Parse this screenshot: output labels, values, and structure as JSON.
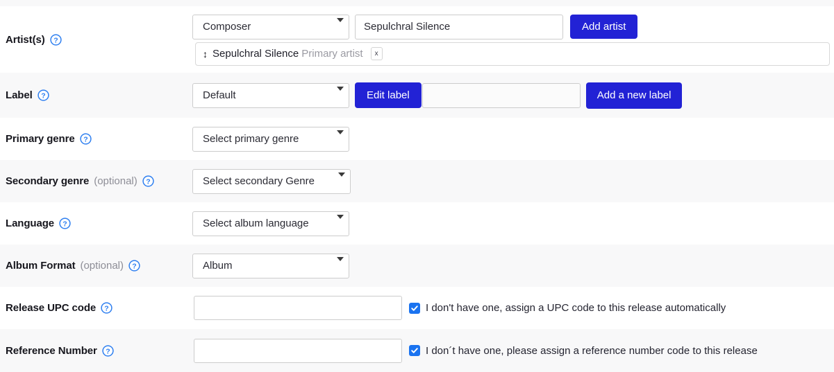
{
  "rows": {
    "artist": {
      "label": "Artist(s)",
      "help_icon": "help-circle-icon",
      "artist_type_select": "Composer",
      "artist_name_value": "Sepulchral Silence",
      "artist_name_placeholder": "",
      "add_button": "Add artist",
      "added": [
        {
          "drag_icon": "drag-vertical-icon",
          "name": "Sepulchral Silence",
          "role": "Primary artist",
          "remove_label": "x"
        }
      ]
    },
    "label": {
      "label": "Label",
      "help_icon": "help-circle-icon",
      "select_value": "Default",
      "edit_button": "Edit label",
      "new_label_value": "",
      "new_label_placeholder": "",
      "add_button": "Add a new label"
    },
    "primary_genre": {
      "label": "Primary genre",
      "help_icon": "help-circle-icon",
      "select_value": "Select primary genre"
    },
    "secondary_genre": {
      "label": "Secondary genre",
      "optional": "(optional)",
      "help_icon": "help-circle-icon",
      "select_value": "Select secondary Genre"
    },
    "language": {
      "label": "Language",
      "help_icon": "help-circle-icon",
      "select_value": "Select album language"
    },
    "album_format": {
      "label": "Album Format",
      "optional": "(optional)",
      "help_icon": "help-circle-icon",
      "select_value": "Album"
    },
    "upc": {
      "label": "Release UPC code",
      "help_icon": "help-circle-icon",
      "input_value": "",
      "input_placeholder": "",
      "checkbox_checked": true,
      "checkbox_text": "I don't have one, assign a UPC code to this release automatically"
    },
    "reference": {
      "label": "Reference Number",
      "help_icon": "help-circle-icon",
      "input_value": "",
      "input_placeholder": "",
      "checkbox_checked": true,
      "checkbox_text": "I don´t have one, please assign a reference number code to this release"
    }
  },
  "colors": {
    "accent_blue": "#2222d5",
    "checkbox_blue": "#1a73f0",
    "help_icon_blue": "#2e7ff0",
    "row_shade": "#f8f8f9",
    "row_white": "#ffffff",
    "border_gray": "#cccccc",
    "muted_text": "#9a9aa2"
  }
}
